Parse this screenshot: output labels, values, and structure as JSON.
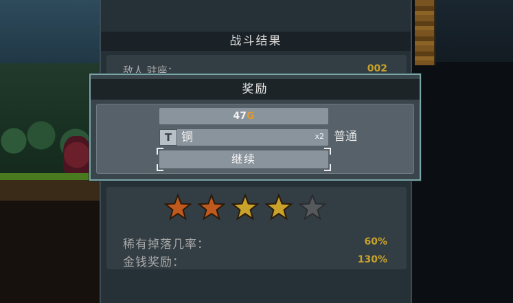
{
  "results": {
    "title": "战斗结果",
    "enemy_kill_label": "敌人 驻座：",
    "enemy_kill_value": "002",
    "stars": {
      "filled": 4,
      "total": 5,
      "colors": [
        "#c0591d",
        "#c0591d",
        "#c8a22a",
        "#c8a22a",
        "#55595c"
      ]
    },
    "rare_drop_label": "稀有掉落几率：",
    "rare_drop_value": "60%",
    "gold_reward_label": "金钱奖励：",
    "gold_reward_value": "130%"
  },
  "reward_dialog": {
    "title": "奖励",
    "gold_amount": "47",
    "gold_unit": "G",
    "item": {
      "icon": "hammer-icon",
      "icon_glyph": "T",
      "name": "铜",
      "quantity": "x2",
      "rarity": "普通"
    },
    "continue_label": "继续"
  },
  "colors": {
    "accent_gold": "#c8a22a",
    "coin_orange": "#e59a2c",
    "dialog_border": "#7aa6a8"
  }
}
